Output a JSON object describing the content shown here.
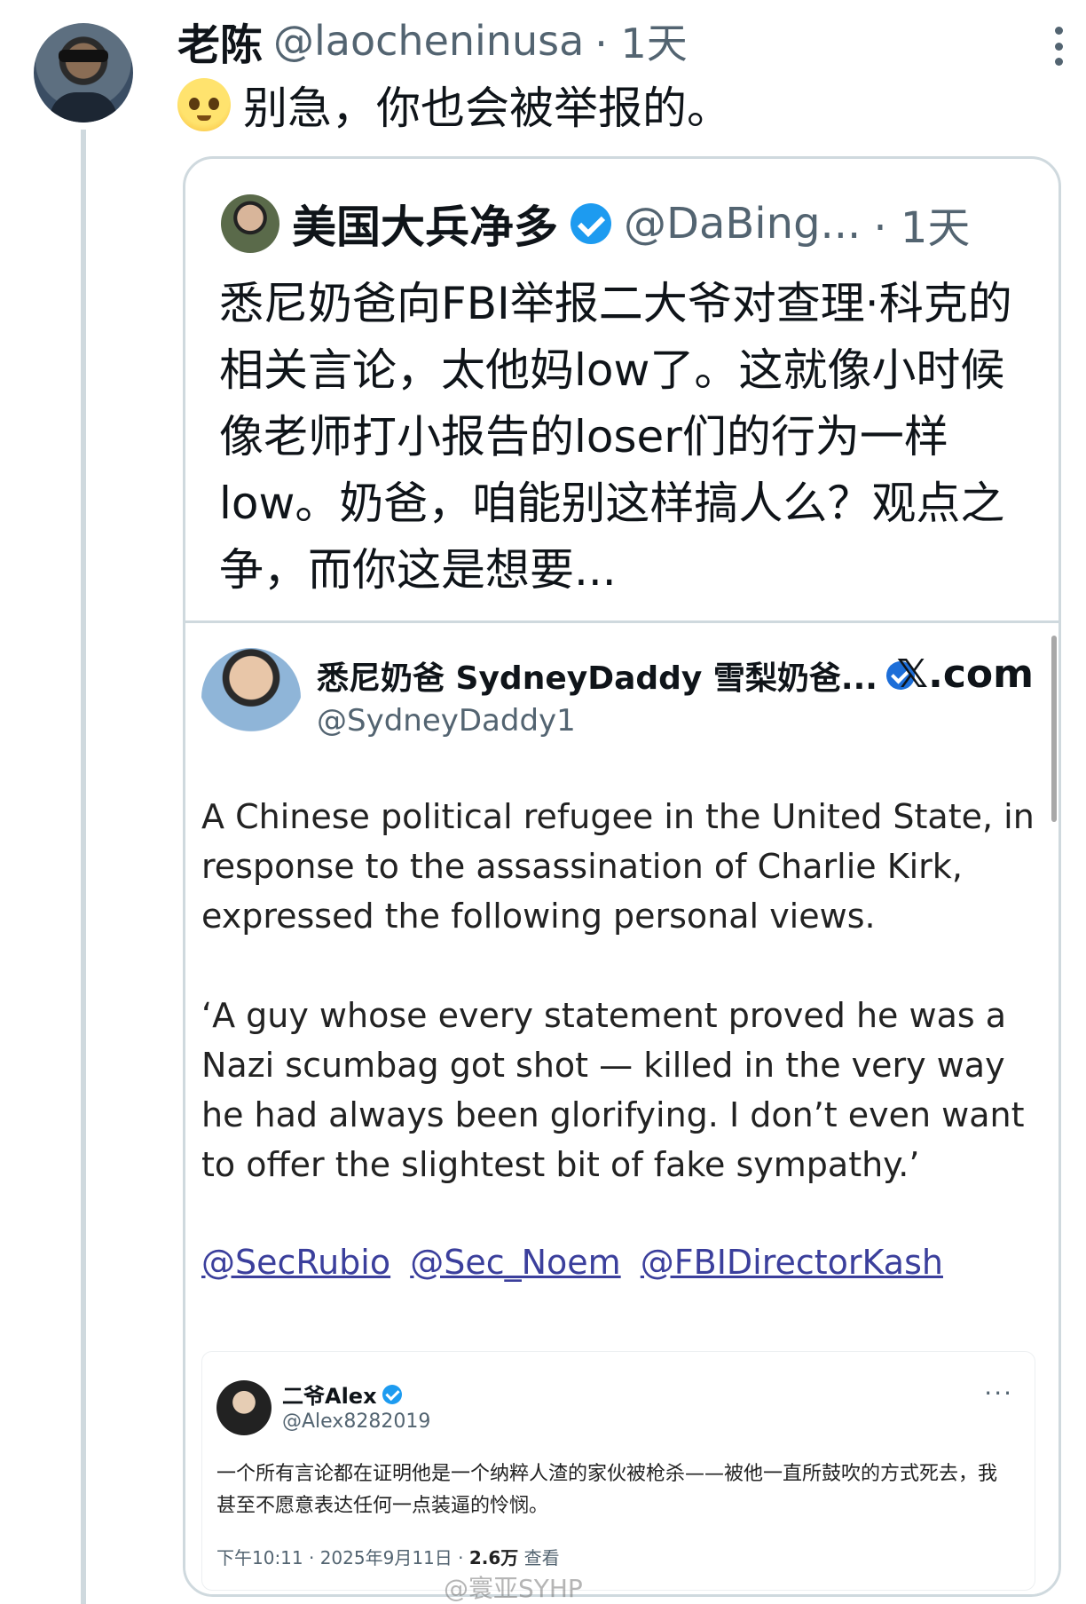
{
  "reply": {
    "display_name": "老陈",
    "handle": "@laocheninusa",
    "time": "· 1天",
    "text": "别急，你也会被举报的。",
    "emoji": "teary-smile-emoji"
  },
  "quote": {
    "display_name": "美国大兵净多",
    "handle": "@DaBing...",
    "time": "· 1天",
    "body": "悉尼奶爸向FBI举报二大爷对查理·科克的相关言论，太他妈low了。这就像小时候像老师打小报告的loser们的行为一样low。奶爸，咱能别这样搞人么？观点之争，而你这是想要..."
  },
  "embed": {
    "display_name": "悉尼奶爸 SydneyDaddy 雪梨奶爸...",
    "handle": "@SydneyDaddy1",
    "source": "𝕏.com",
    "paragraph1": "A Chinese political refugee in the United State, in response to the assassination of Charlie Kirk, expressed the following personal views.",
    "paragraph2": "‘A guy whose every statement proved he was a Nazi scumbag got shot — killed in the very way he had always been glorifying. I don’t even want to offer the slightest bit of fake sympathy.’",
    "mentions": [
      "@SecRubio",
      "@Sec_Noem",
      "@FBIDirectorKash"
    ]
  },
  "inner": {
    "display_name": "二爷Alex",
    "handle": "@Alex8282019",
    "more": "···",
    "text": "一个所有言论都在证明他是一个纳粹人渣的家伙被枪杀——被他一直所鼓吹的方式死去，我甚至不愿意表达任何一点装逼的怜悯。",
    "meta_time": "下午10:11 · 2025年9月11日 · ",
    "meta_views": "2.6万",
    "meta_views_label": " 查看"
  },
  "watermark": "@寰亚SYHP"
}
